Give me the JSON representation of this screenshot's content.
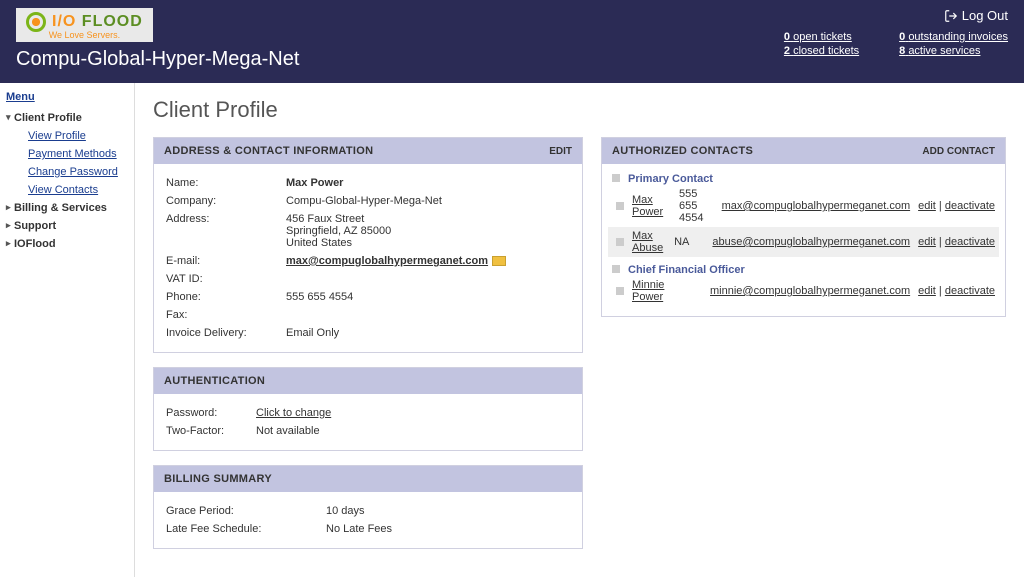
{
  "header": {
    "logo_main": "I/O",
    "logo_flood": " FLOOD",
    "logo_sub": "We Love Servers.",
    "client_name": "Compu-Global-Hyper-Mega-Net",
    "logout": "Log Out",
    "stats": {
      "open_tickets_n": "0",
      "open_tickets": "open tickets",
      "closed_tickets_n": "2",
      "closed_tickets": "closed tickets",
      "outstanding_n": "0",
      "outstanding": "outstanding invoices",
      "active_n": "8",
      "active": "active services"
    }
  },
  "menu": {
    "title": "Menu",
    "items": [
      {
        "label": "Client Profile",
        "open": true,
        "children": [
          {
            "label": "View Profile"
          },
          {
            "label": "Payment Methods"
          },
          {
            "label": "Change Password"
          },
          {
            "label": "View Contacts"
          }
        ]
      },
      {
        "label": "Billing & Services"
      },
      {
        "label": "Support"
      },
      {
        "label": "IOFlood"
      }
    ]
  },
  "page_title": "Client Profile",
  "address_panel": {
    "title": "ADDRESS & CONTACT INFORMATION",
    "action": "EDIT",
    "name_k": "Name:",
    "name_v": "Max Power",
    "company_k": "Company:",
    "company_v": "Compu-Global-Hyper-Mega-Net",
    "address_k": "Address:",
    "address_l1": "456 Faux Street",
    "address_l2": "Springfield, AZ 85000",
    "address_l3": "United States",
    "email_k": "E-mail:",
    "email_v": "max@compuglobalhypermeganet.com",
    "vat_k": "VAT ID:",
    "vat_v": "",
    "phone_k": "Phone:",
    "phone_v": "555 655 4554",
    "fax_k": "Fax:",
    "fax_v": "",
    "inv_k": "Invoice Delivery:",
    "inv_v": "Email Only"
  },
  "auth_panel": {
    "title": "AUTHENTICATION",
    "pw_k": "Password:",
    "pw_v": "Click to change",
    "tf_k": "Two-Factor:",
    "tf_v": "Not available"
  },
  "billing_panel": {
    "title": "BILLING SUMMARY",
    "grace_k": "Grace Period:",
    "grace_v": "10 days",
    "late_k": "Late Fee Schedule:",
    "late_v": "No Late Fees"
  },
  "contacts_panel": {
    "title": "AUTHORIZED CONTACTS",
    "action": "ADD CONTACT",
    "edit": "edit",
    "deact": "deactivate",
    "sep": " | ",
    "groups": [
      {
        "role": "Primary Contact",
        "rows": [
          {
            "name": "Max Power",
            "phone": "555 655 4554",
            "email": "max@compuglobalhypermeganet.com",
            "alt": false
          },
          {
            "name": "Max Abuse",
            "phone": "NA",
            "email": "abuse@compuglobalhypermeganet.com",
            "alt": true
          }
        ]
      },
      {
        "role": "Chief Financial Officer",
        "rows": [
          {
            "name": "Minnie Power",
            "phone": "",
            "email": "minnie@compuglobalhypermeganet.com",
            "alt": false
          }
        ]
      }
    ]
  }
}
